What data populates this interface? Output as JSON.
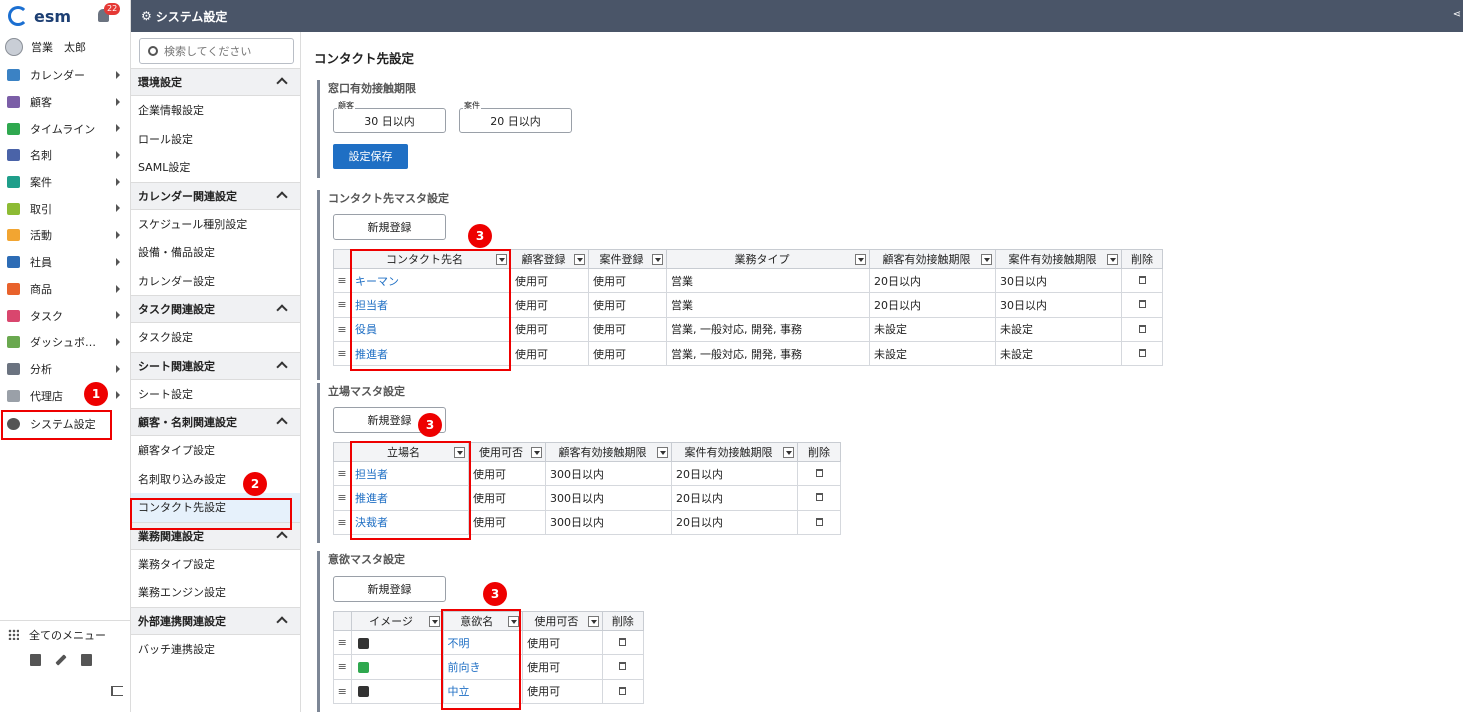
{
  "app": {
    "logo_text": "esm",
    "notification_count": "22",
    "user_name": "営業　太郎"
  },
  "nav": {
    "items": [
      {
        "label": "カレンダー",
        "color": "#3b82c4"
      },
      {
        "label": "顧客",
        "color": "#7b5ea7"
      },
      {
        "label": "タイムライン",
        "color": "#2fa84f"
      },
      {
        "label": "名刺",
        "color": "#4a63a8"
      },
      {
        "label": "案件",
        "color": "#1f9e8a"
      },
      {
        "label": "取引",
        "color": "#8dbb34"
      },
      {
        "label": "活動",
        "color": "#f2a531"
      },
      {
        "label": "社員",
        "color": "#2d6cb5"
      },
      {
        "label": "商品",
        "color": "#e8622c"
      },
      {
        "label": "タスク",
        "color": "#d9466e"
      },
      {
        "label": "ダッシュボ…",
        "color": "#6aa84f"
      },
      {
        "label": "分析",
        "color": "#6b7380"
      },
      {
        "label": "代理店",
        "color": "#9aa0a8"
      }
    ],
    "system_settings": "システム設定",
    "all_menu": "全てのメニュー"
  },
  "header": {
    "title": "システム設定"
  },
  "submenu": {
    "search_placeholder": "検索してください",
    "sections": [
      {
        "title": "環境設定",
        "items": [
          "企業情報設定",
          "ロール設定",
          "SAML設定"
        ]
      },
      {
        "title": "カレンダー関連設定",
        "items": [
          "スケジュール種別設定",
          "設備・備品設定",
          "カレンダー設定"
        ]
      },
      {
        "title": "タスク関連設定",
        "items": [
          "タスク設定"
        ]
      },
      {
        "title": "シート関連設定",
        "items": [
          "シート設定"
        ]
      },
      {
        "title": "顧客・名刺関連設定",
        "items": [
          "顧客タイプ設定",
          "名刺取り込み設定",
          "コンタクト先設定"
        ]
      },
      {
        "title": "業務関連設定",
        "items": [
          "業務タイプ設定",
          "業務エンジン設定"
        ]
      },
      {
        "title": "外部連携関連設定",
        "items": [
          "バッチ連携設定"
        ]
      }
    ]
  },
  "main": {
    "page_title": "コンタクト先設定",
    "window": {
      "title": "窓口有効接触期限",
      "customer_legend": "顧客",
      "customer_value": "30 日以内",
      "deal_legend": "案件",
      "deal_value": "20 日以内",
      "save_label": "設定保存"
    },
    "contact_master": {
      "title": "コンタクト先マスタ設定",
      "new_label": "新規登録",
      "headers": [
        "コンタクト先名",
        "顧客登録",
        "案件登録",
        "業務タイプ",
        "顧客有効接触期限",
        "案件有効接触期限",
        "削除"
      ],
      "rows": [
        [
          "キーマン",
          "使用可",
          "使用可",
          "営業",
          "20日以内",
          "30日以内"
        ],
        [
          "担当者",
          "使用可",
          "使用可",
          "営業",
          "20日以内",
          "30日以内"
        ],
        [
          "役員",
          "使用可",
          "使用可",
          "営業, 一般対応, 開発, 事務",
          "未設定",
          "未設定"
        ],
        [
          "推進者",
          "使用可",
          "使用可",
          "営業, 一般対応, 開発, 事務",
          "未設定",
          "未設定"
        ]
      ]
    },
    "position_master": {
      "title": "立場マスタ設定",
      "new_label": "新規登録",
      "headers": [
        "立場名",
        "使用可否",
        "顧客有効接触期限",
        "案件有効接触期限",
        "削除"
      ],
      "rows": [
        [
          "担当者",
          "使用可",
          "300日以内",
          "20日以内"
        ],
        [
          "推進者",
          "使用可",
          "300日以内",
          "20日以内"
        ],
        [
          "決裁者",
          "使用可",
          "300日以内",
          "20日以内"
        ]
      ]
    },
    "motivation_master": {
      "title": "意欲マスタ設定",
      "new_label": "新規登録",
      "headers": [
        "イメージ",
        "意欲名",
        "使用可否",
        "削除"
      ],
      "rows": [
        {
          "icon": "minus-icon",
          "color": "#333333",
          "name": "不明",
          "usable": "使用可"
        },
        {
          "icon": "arrow-up-right-icon",
          "color": "#2fa84f",
          "name": "前向き",
          "usable": "使用可"
        },
        {
          "icon": "arrow-right-icon",
          "color": "#333333",
          "name": "中立",
          "usable": "使用可"
        }
      ]
    }
  },
  "annotations": [
    "1",
    "2",
    "3",
    "3",
    "3"
  ]
}
